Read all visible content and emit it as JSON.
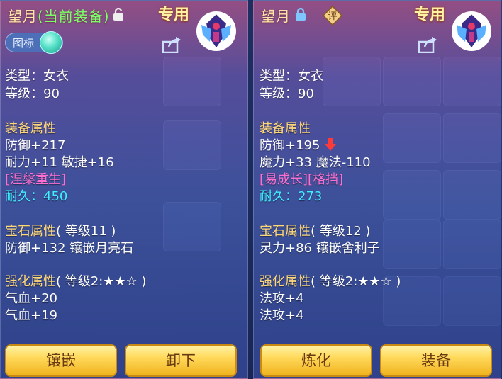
{
  "left": {
    "name": "望月",
    "status": "(当前装备)",
    "exclusive": "专用",
    "toggle_label": "图标",
    "type": "类型：女衣",
    "level": "等级：90",
    "equip_header": "装备属性",
    "def": "防御+217",
    "stats2": "耐力+11 敏捷+16",
    "special": "[涅槃重生]",
    "durability": "耐久：450",
    "gem_header": "宝石属性",
    "gem_level": "( 等级11 )",
    "gem_stat": "防御+132 镶嵌月亮石",
    "enh_header": "强化属性",
    "enh_level": "( 等级2:★★☆ )",
    "enh1": "气血+20",
    "enh2": "气血+19",
    "btn1": "镶嵌",
    "btn2": "卸下"
  },
  "right": {
    "name": "望月",
    "rating": "评",
    "exclusive": "专用",
    "type": "类型：女衣",
    "level": "等级：90",
    "equip_header": "装备属性",
    "def": "防御+195",
    "stats2": "魔力+33 魔法-110",
    "special": "[易成长][格挡]",
    "durability": "耐久：273",
    "gem_header": "宝石属性",
    "gem_level": "( 等级12 )",
    "gem_stat": "灵力+86 镶嵌舍利子",
    "enh_header": "强化属性",
    "enh_level": "( 等级2:★★☆ )",
    "enh1": "法攻+4",
    "enh2": "法攻+4",
    "btn1": "炼化",
    "btn2": "装备"
  },
  "icons": {
    "lock_open": "unlock-icon",
    "lock_closed": "lock-icon",
    "share": "share-icon",
    "emblem": "costume-emblem-icon",
    "arrow": "down-arrow-icon"
  },
  "colors": {
    "section": "#ffd87a",
    "special": "#ff6fd0",
    "durability": "#3ff0ff",
    "button": "#ffd95a"
  }
}
